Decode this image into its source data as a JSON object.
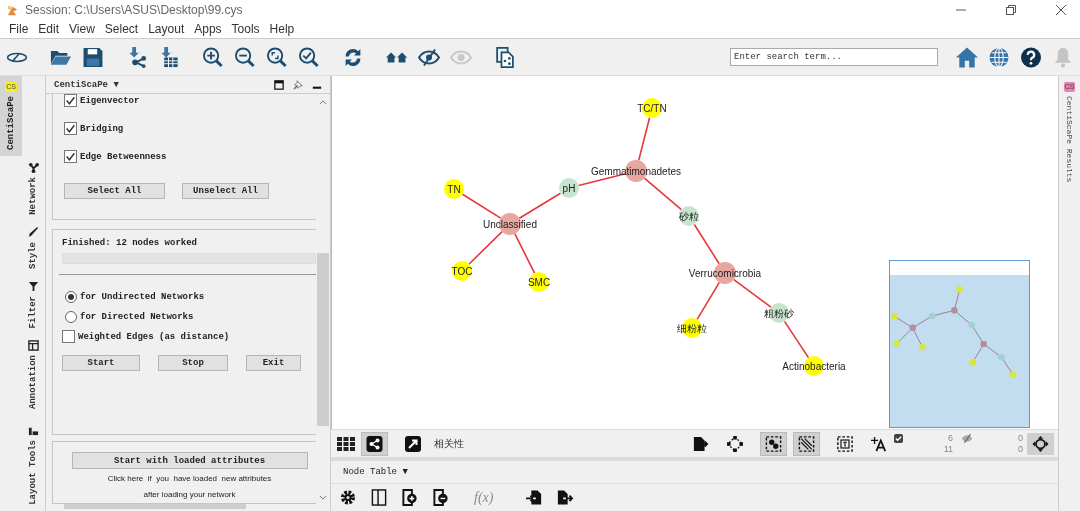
{
  "window": {
    "title": "Session: C:\\Users\\ASUS\\Desktop\\99.cys"
  },
  "menu": [
    "File",
    "Edit",
    "View",
    "Select",
    "Layout",
    "Apps",
    "Tools",
    "Help"
  ],
  "search": {
    "placeholder": "Enter search term..."
  },
  "side_tabs": [
    {
      "label": "CentiScaPe",
      "badge": "CS",
      "selected": true
    },
    {
      "label": "Network",
      "selected": false
    },
    {
      "label": "Style",
      "selected": false
    },
    {
      "label": "Filter",
      "selected": false
    },
    {
      "label": "Annotation",
      "selected": false
    },
    {
      "label": "Layout Tools",
      "selected": false
    }
  ],
  "panel": {
    "title": "CentiScaPe ▼",
    "centralities": [
      {
        "label": "Eigenvector",
        "checked": true
      },
      {
        "label": "Bridging",
        "checked": true
      },
      {
        "label": "Edge Betweenness",
        "checked": true
      }
    ],
    "select_buttons": [
      "Select All",
      "Unselect All"
    ],
    "status": "Finished: 12 nodes worked",
    "progress": {
      "level": 0
    },
    "modes": [
      {
        "label": "for Undirected Networks",
        "selected": true
      },
      {
        "label": "for Directed Networks",
        "selected": false
      }
    ],
    "weighted": {
      "label": "Weighted Edges (as distance)",
      "checked": false
    },
    "actions": [
      "Start",
      "Stop",
      "Exit"
    ],
    "loaded_button": "Start with loaded attributes",
    "hint": "Click here  if  you  have loaded  new attributes after loading your network"
  },
  "network": {
    "nodes": [
      {
        "label": "TC/TN",
        "color": "#ffff00"
      },
      {
        "label": "Gemmatimonadetes",
        "color": "#e8a6a1"
      },
      {
        "label": "TN",
        "color": "#ffff00"
      },
      {
        "label": "pH",
        "color": "#c7e4cc"
      },
      {
        "label": "Unclassified",
        "color": "#e8a6a1"
      },
      {
        "label": "砂粒",
        "color": "#c7e4cc"
      },
      {
        "label": "TOC",
        "color": "#ffff00"
      },
      {
        "label": "SMC",
        "color": "#ffff00"
      },
      {
        "label": "Verrucomicrobia",
        "color": "#e8a6a1"
      },
      {
        "label": "粗粉砂",
        "color": "#c7e4cc"
      },
      {
        "label": "细粉粒",
        "color": "#ffff00"
      },
      {
        "label": "Actinobacteria",
        "color": "#ffff00"
      }
    ]
  },
  "network_toolbar": {
    "name": "相关性"
  },
  "counts": {
    "selected": [
      "6",
      "11"
    ],
    "hidden": [
      "0",
      "0"
    ]
  },
  "table_panel": {
    "title": "Node Table ▼",
    "function_label": "f(x)"
  },
  "right_tabs": [
    {
      "label": "CentiScaPe Results",
      "badge": "CS",
      "selected": false
    }
  ]
}
